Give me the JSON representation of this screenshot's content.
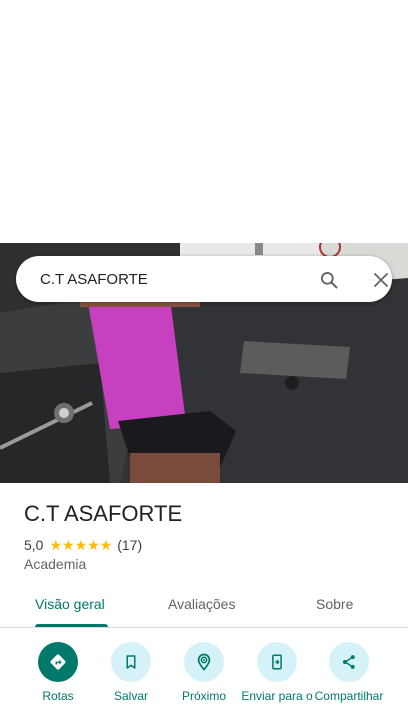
{
  "search": {
    "query": "C.T ASAFORTE",
    "search_icon": "search-icon",
    "close_icon": "close-icon"
  },
  "hero": {
    "image": "gym-photo"
  },
  "place": {
    "name": "C.T ASAFORTE",
    "rating": "5,0",
    "stars": "★★★★★",
    "star_count": 5,
    "reviews": "(17)",
    "category": "Academia"
  },
  "tabs": [
    {
      "label": "Visão geral",
      "active": true
    },
    {
      "label": "Avaliações",
      "active": false
    },
    {
      "label": "Sobre",
      "active": false
    }
  ],
  "actions": [
    {
      "label": "Rotas",
      "icon": "directions-icon"
    },
    {
      "label": "Salvar",
      "icon": "bookmark-icon"
    },
    {
      "label": "Próximo",
      "icon": "nearby-icon"
    },
    {
      "label": "Enviar para o",
      "icon": "send-to-phone-icon"
    },
    {
      "label": "Compartilhar",
      "icon": "share-icon"
    }
  ],
  "colors": {
    "accent": "#00796b",
    "action_bg": "#d5f2f9",
    "star": "#fbbc04"
  }
}
